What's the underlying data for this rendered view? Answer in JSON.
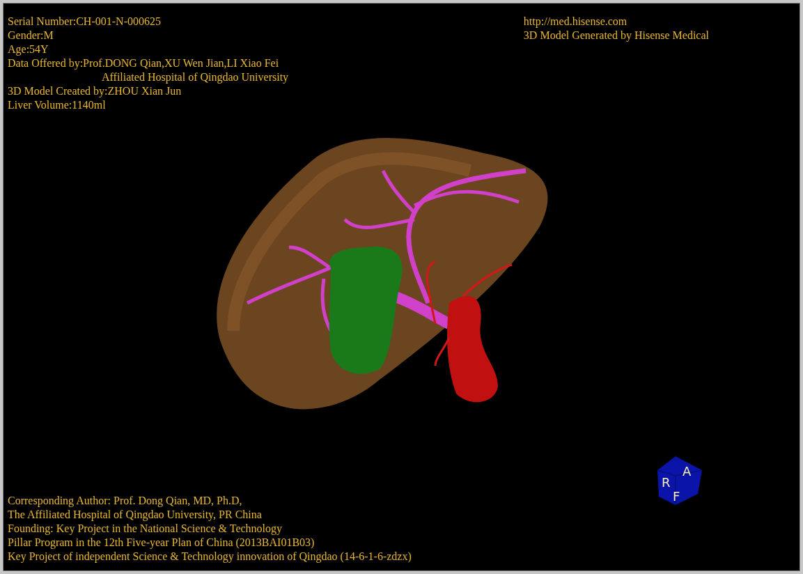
{
  "patient_info": [
    {
      "text": "Serial Number:CH-001-N-000625",
      "indent": false
    },
    {
      "text": "Gender:M",
      "indent": false
    },
    {
      "text": "Age:54Y",
      "indent": false
    },
    {
      "text": "Data Offered by:Prof.DONG Qian,XU Wen Jian,LI Xiao Fei",
      "indent": false
    },
    {
      "text": "Affiliated Hospital of Qingdao University",
      "indent": true
    },
    {
      "text": "3D Model Created by:ZHOU Xian Jun",
      "indent": false
    },
    {
      "text": "Liver Volume:1140ml",
      "indent": false
    }
  ],
  "vendor_info": [
    "http://med.hisense.com",
    "3D Model Generated by Hisense Medical"
  ],
  "orientation_cube": {
    "labels": [
      "R",
      "A",
      "F"
    ]
  },
  "credits": [
    "Corresponding Author: Prof. Dong Qian, MD, Ph.D,",
    "The Affiliated Hospital of Qingdao University, PR China",
    "Founding: Key Project in the National Science & Technology",
    "Pillar Program in the 12th Five-year Plan of China (2013BAI01B03)",
    "Key Project of independent Science & Technology innovation of Qingdao (14-6-1-6-zdzx)"
  ]
}
